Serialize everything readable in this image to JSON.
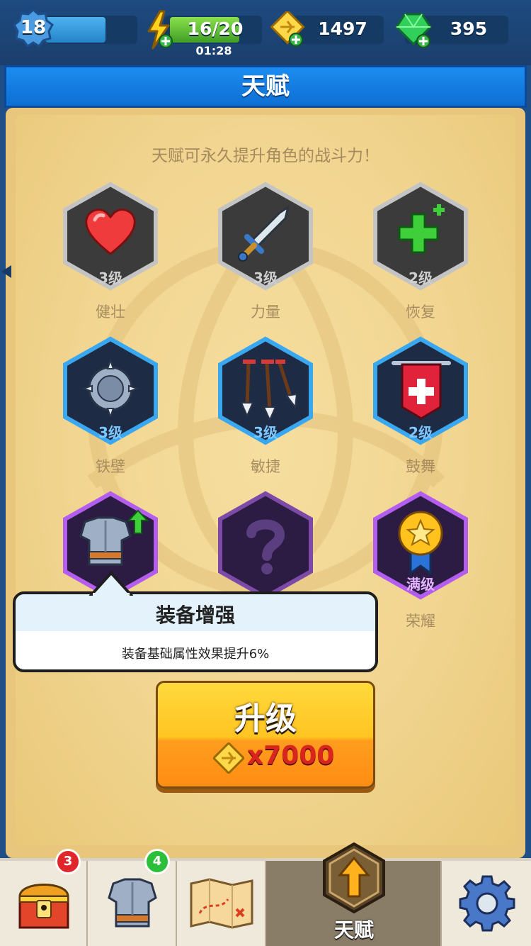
{
  "header": {
    "player_level": "18",
    "player_xp_fraction": 0.65,
    "energy": "16/20",
    "energy_fraction": 0.8,
    "energy_timer": "01:28",
    "gold": "1497",
    "gems": "395"
  },
  "title": "天赋",
  "subtitle": "天赋可永久提升角色的战斗力！",
  "talents": [
    {
      "name": "健壮",
      "level": "3级",
      "icon": "heart-icon",
      "tier": "gray"
    },
    {
      "name": "力量",
      "level": "3级",
      "icon": "sword-icon",
      "tier": "gray"
    },
    {
      "name": "恢复",
      "level": "2级",
      "icon": "green-plus-icon",
      "tier": "gray"
    },
    {
      "name": "铁壁",
      "level": "3级",
      "icon": "spiked-shield-icon",
      "tier": "blue"
    },
    {
      "name": "敏捷",
      "level": "3级",
      "icon": "arrows-icon",
      "tier": "blue"
    },
    {
      "name": "鼓舞",
      "level": "2级",
      "icon": "banner-icon",
      "tier": "blue"
    },
    {
      "name": "装备增强",
      "level": "",
      "icon": "armor-icon",
      "tier": "purple"
    },
    {
      "name": "",
      "level": "",
      "icon": "question-icon",
      "tier": "purple"
    },
    {
      "name": "荣耀",
      "level": "满级",
      "icon": "medal-icon",
      "tier": "purple"
    }
  ],
  "tooltip": {
    "title": "装备增强",
    "description": "装备基础属性效果提升6%"
  },
  "upgrade": {
    "label": "升级",
    "cost": "x7000"
  },
  "nav": {
    "chest_badge": "3",
    "equipment_badge": "4",
    "active_label": "天赋"
  },
  "colors": {
    "title_bar": "#1c8cf0",
    "parchment": "#f1d590",
    "tier_gray": "#bfbfbf",
    "tier_blue": "#3aa8f0",
    "tier_purple": "#b45ef0",
    "upgrade_button": "#ffc522",
    "cost_text": "#d8251e"
  }
}
